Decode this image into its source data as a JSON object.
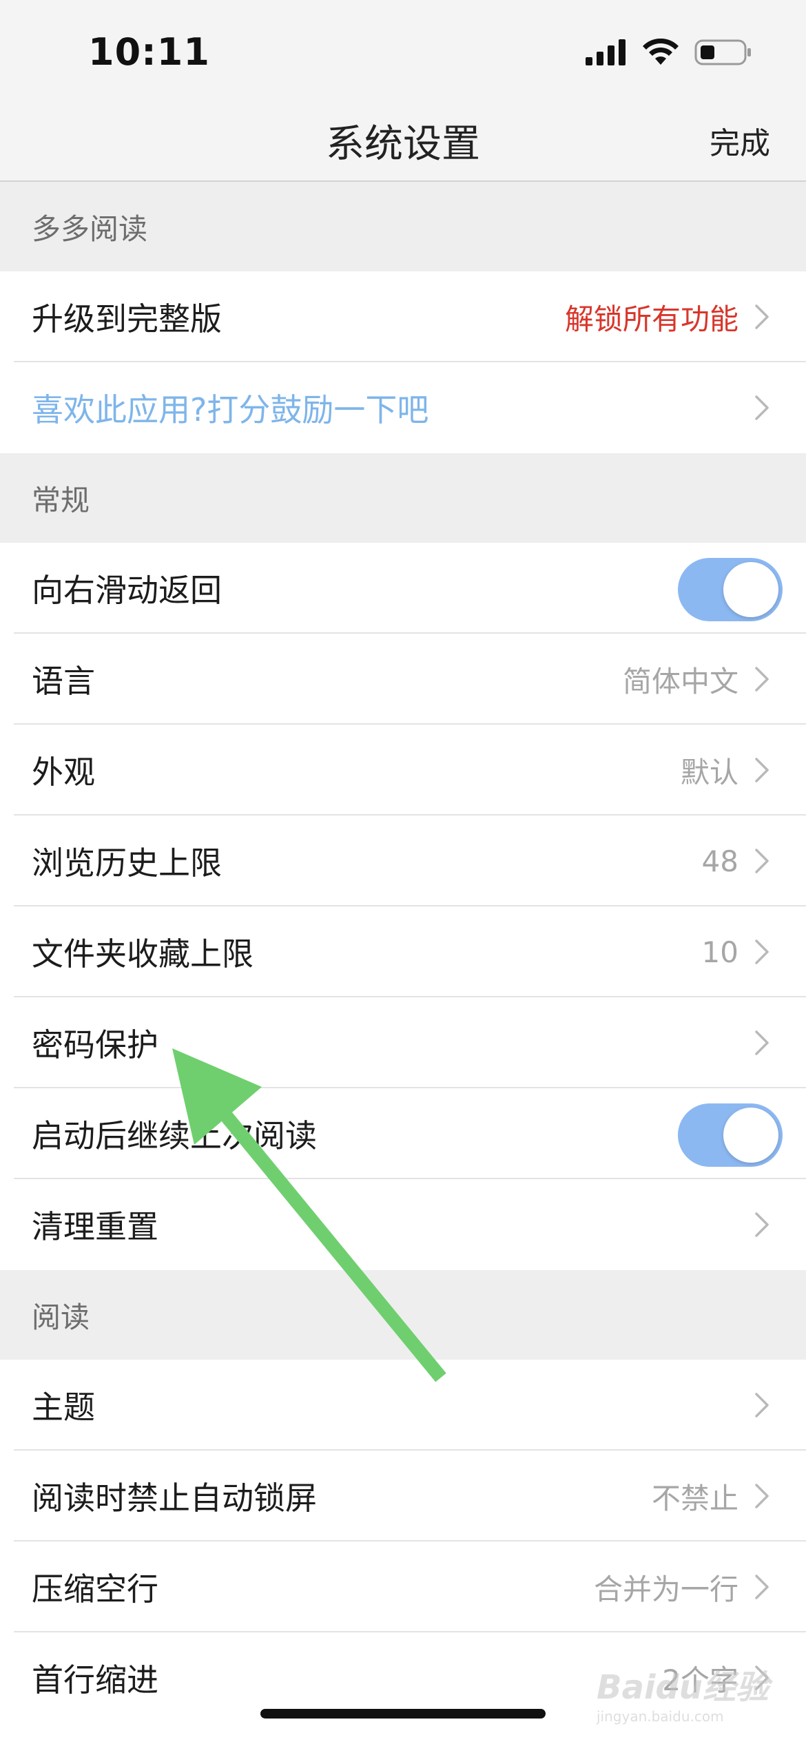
{
  "status_bar": {
    "time": "10:11",
    "icons": [
      "cellular-signal-icon",
      "wifi-icon",
      "battery-icon"
    ]
  },
  "nav": {
    "title": "系统设置",
    "done_label": "完成"
  },
  "sections": {
    "duoduo": {
      "header": "多多阅读",
      "upgrade_label": "升级到完整版",
      "upgrade_value": "解锁所有功能",
      "rate_label": "喜欢此应用?打分鼓励一下吧"
    },
    "general": {
      "header": "常规",
      "swipe_back_label": "向右滑动返回",
      "swipe_back_on": true,
      "language_label": "语言",
      "language_value": "简体中文",
      "appearance_label": "外观",
      "appearance_value": "默认",
      "history_limit_label": "浏览历史上限",
      "history_limit_value": "48",
      "folder_limit_label": "文件夹收藏上限",
      "folder_limit_value": "10",
      "password_label": "密码保护",
      "resume_reading_label": "启动后继续上次阅读",
      "resume_reading_on": true,
      "reset_label": "清理重置"
    },
    "reading": {
      "header": "阅读",
      "theme_label": "主题",
      "no_autolock_label": "阅读时禁止自动锁屏",
      "no_autolock_value": "不禁止",
      "compress_blank_label": "压缩空行",
      "compress_blank_value": "合并为一行",
      "indent_label": "首行缩进",
      "indent_value": "2个字"
    }
  },
  "annotation": {
    "arrow_color": "#6fcf6f"
  },
  "watermark": {
    "text": "Baidu经验",
    "sub": "jingyan.baidu.com"
  },
  "colors": {
    "accent_blue": "#8cb8f2",
    "link_blue": "#7eb5ea",
    "red": "#d8362b"
  }
}
